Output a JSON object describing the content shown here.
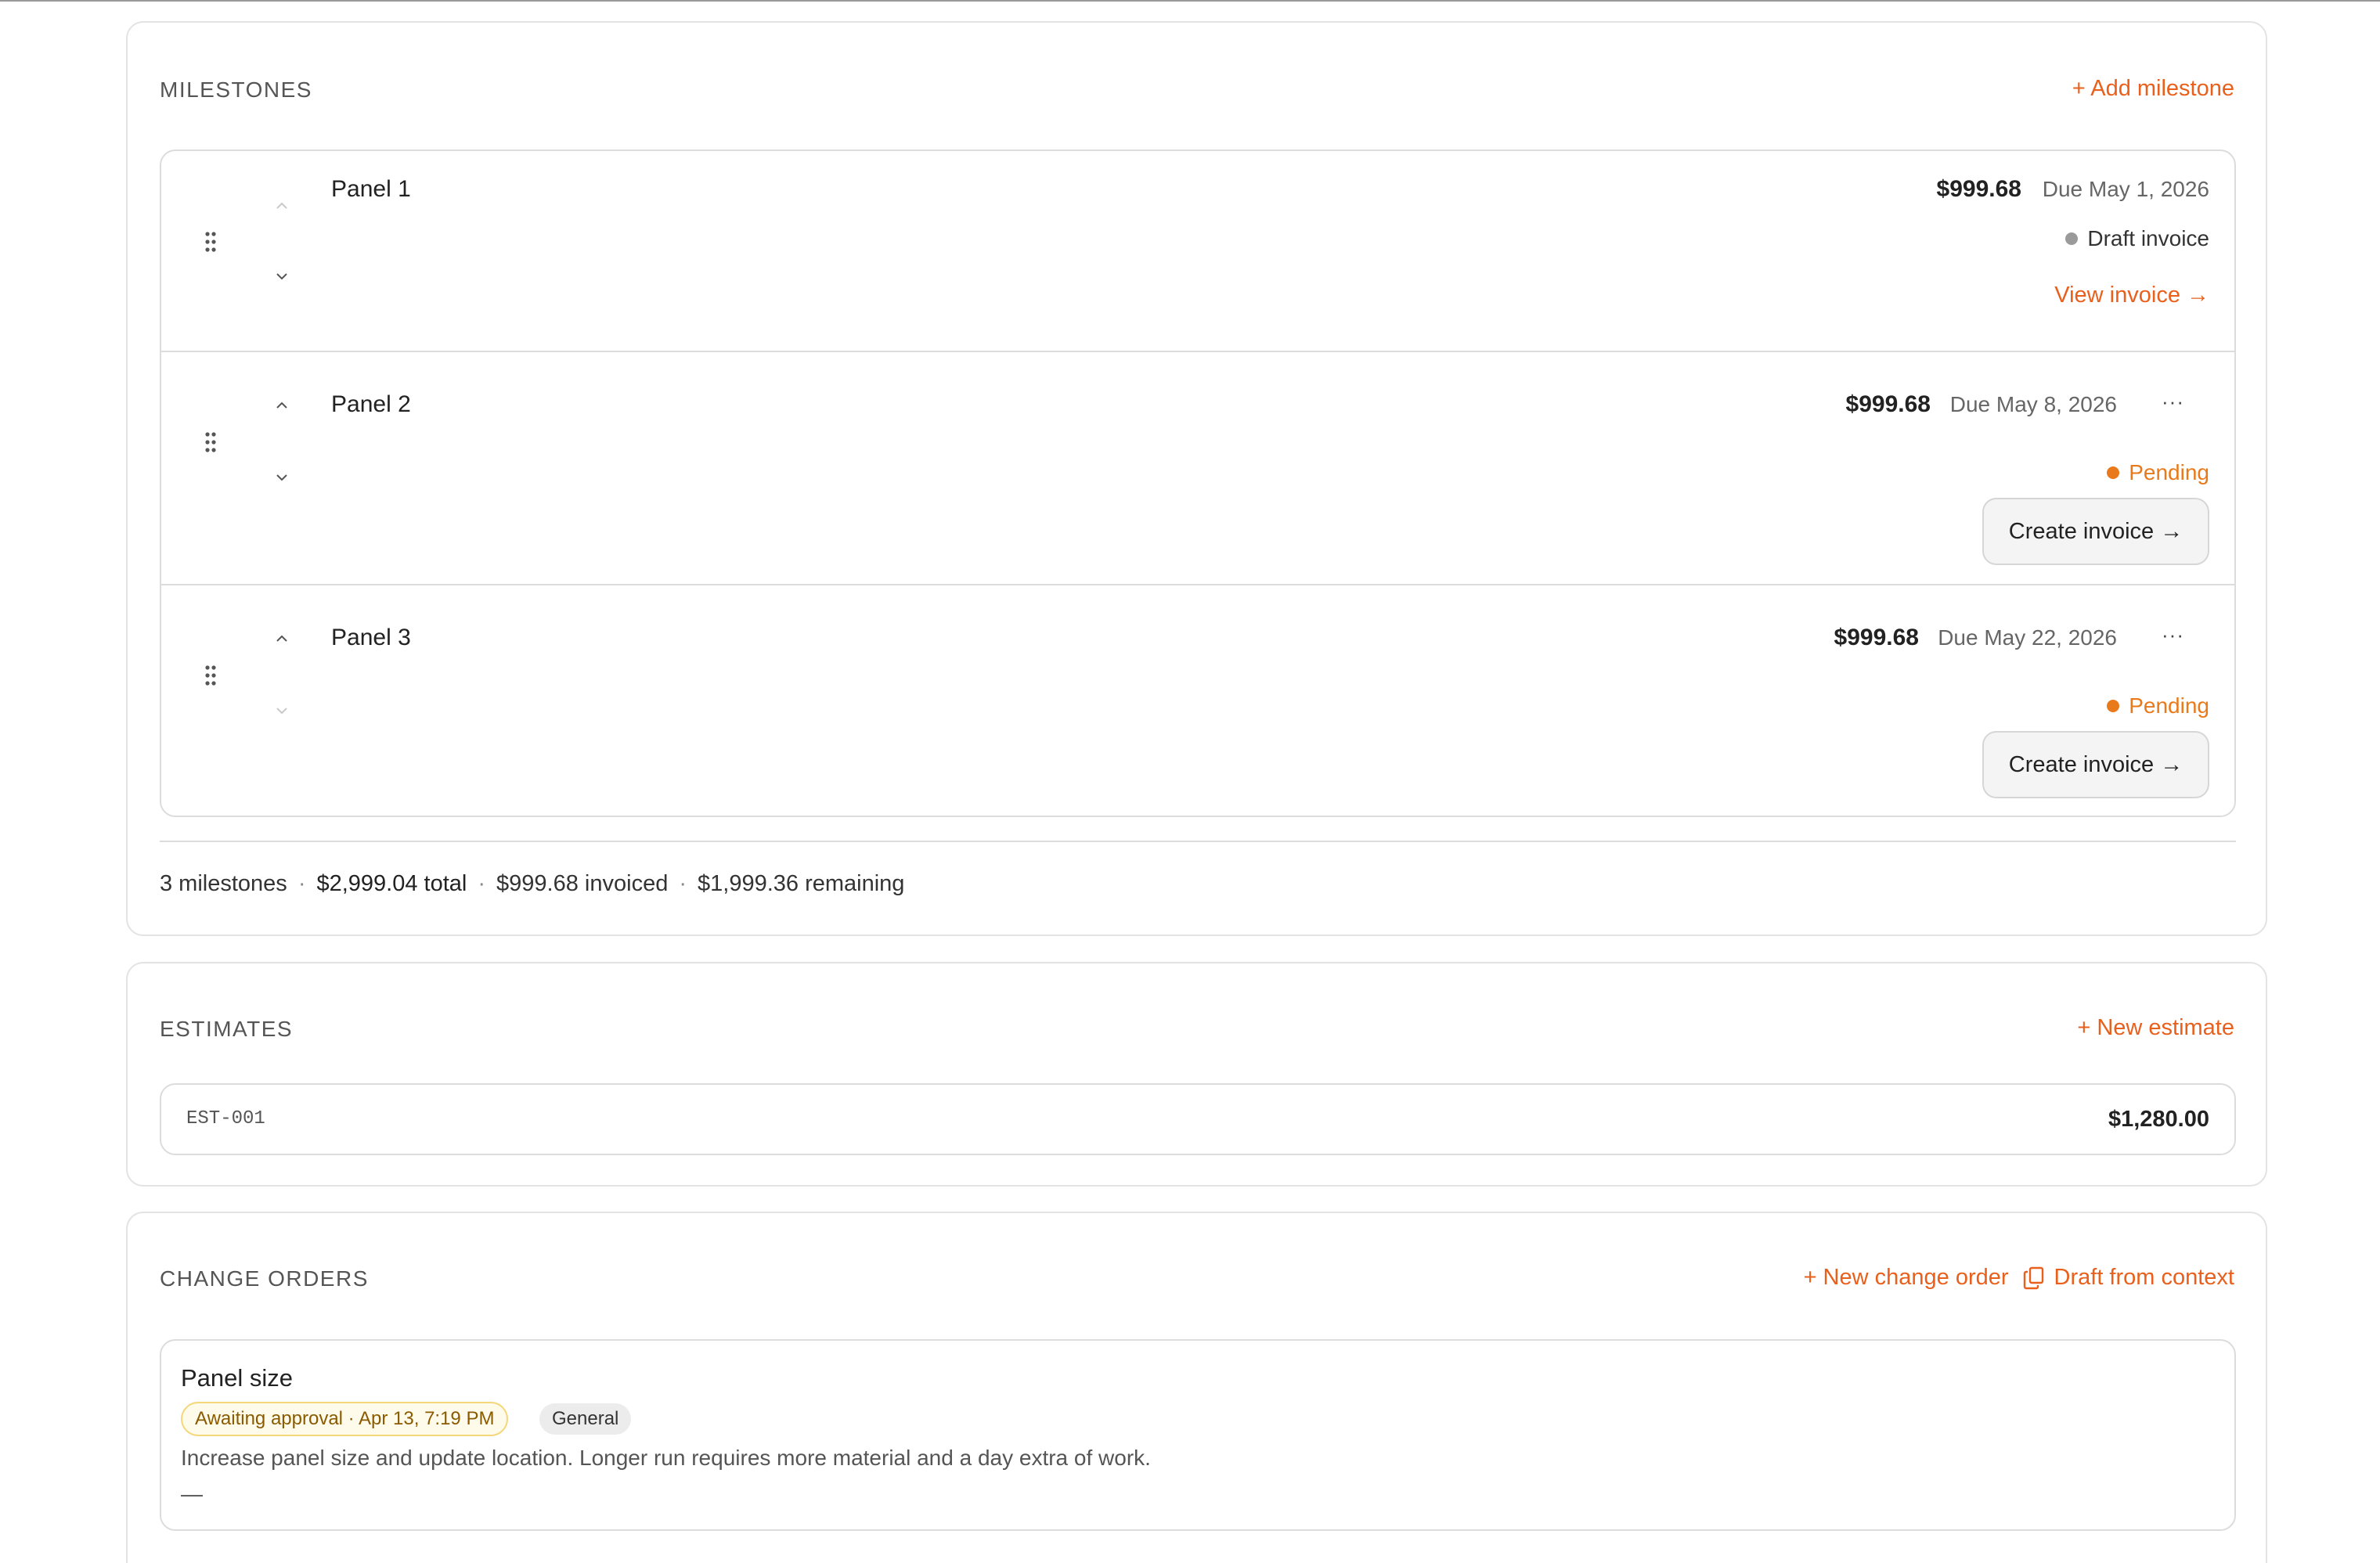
{
  "milestones": {
    "title": "MILESTONES",
    "add_label": "+ Add milestone",
    "items": [
      {
        "name": "Panel 1",
        "amount": "$999.68",
        "due": "Due May 1, 2026",
        "status": "Draft invoice",
        "status_color": "#9a9a9a",
        "action": "View invoice →"
      },
      {
        "name": "Panel 2",
        "amount": "$999.68",
        "due": "Due May 8, 2026",
        "more": "···",
        "status": "Pending",
        "status_color": "#e87a1c",
        "action": "Create invoice →"
      },
      {
        "name": "Panel 3",
        "amount": "$999.68",
        "due": "Due May 22, 2026",
        "more": "···",
        "status": "Pending",
        "status_color": "#e87a1c",
        "action": "Create invoice →"
      }
    ],
    "summary": {
      "count": "3 milestones",
      "total": "$2,999.04 total",
      "invoiced": "$999.68 invoiced",
      "remaining": "$1,999.36 remaining",
      "separator": "·"
    }
  },
  "estimates": {
    "title": "ESTIMATES",
    "new_label": "+ New estimate",
    "items": [
      {
        "id": "EST-001",
        "amount": "$1,280.00"
      }
    ]
  },
  "change_orders": {
    "title": "CHANGE ORDERS",
    "new_label": "+ New change order",
    "draft_label": "Draft from context",
    "draft_icon": "copy-icon",
    "items": [
      {
        "title": "Panel size",
        "status_badge": "Awaiting approval · Apr 13, 7:19 PM",
        "category": "General",
        "description": "Increase panel size and update location. Longer run requires more material and a day extra of work.",
        "dash": "—"
      }
    ]
  },
  "colors": {
    "accent": "#e8601c",
    "pending": "#e87a1c",
    "draft": "#9a9a9a",
    "border": "#dcdcdc"
  }
}
